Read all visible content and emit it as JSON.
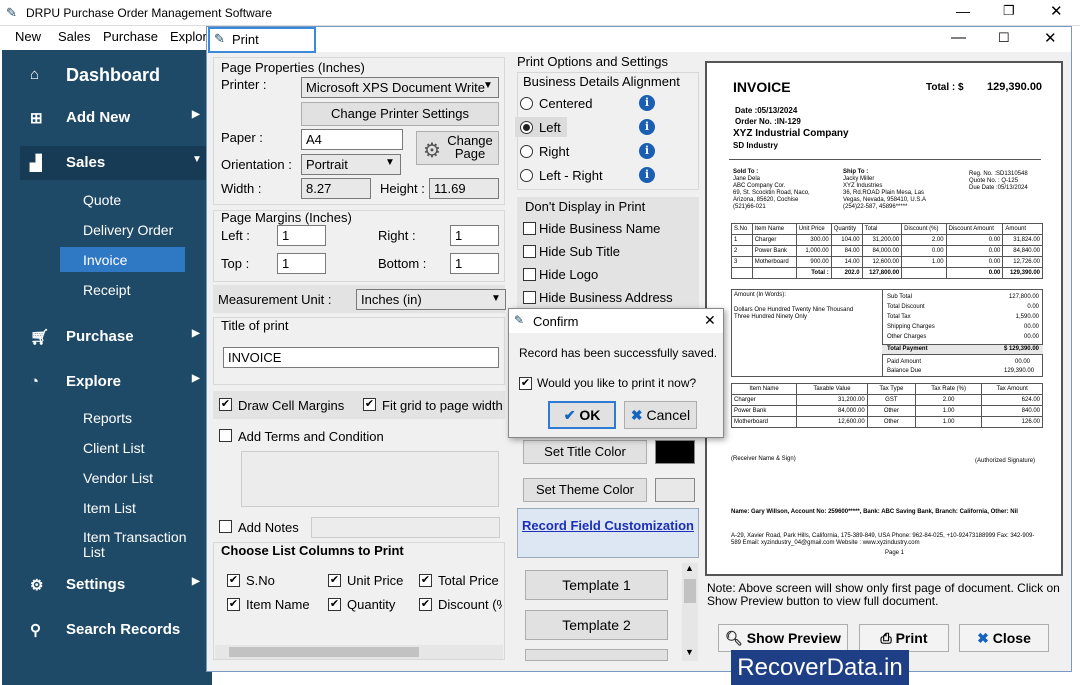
{
  "app": {
    "title": "DRPU Purchase Order Management Software"
  },
  "menu": [
    "New",
    "Sales",
    "Purchase",
    "Explore"
  ],
  "sidebar": {
    "dashboard": "Dashboard",
    "add_new": "Add New",
    "sales": "Sales",
    "sales_sub": [
      "Quote",
      "Delivery Order",
      "Invoice",
      "Receipt"
    ],
    "purchase": "Purchase",
    "explore": "Explore",
    "explore_sub": [
      "Reports",
      "Client List",
      "Vendor List",
      "Item List",
      "Item Transaction List"
    ],
    "settings": "Settings",
    "search": "Search Records"
  },
  "print": {
    "title": "Print",
    "page_properties": {
      "heading": "Page Properties (Inches)",
      "printer_label": "Printer :",
      "printer": "Microsoft XPS Document Write",
      "change_printer": "Change Printer Settings",
      "paper_label": "Paper :",
      "paper": "A4",
      "orientation_label": "Orientation :",
      "orientation": "Portrait",
      "change_page": "Change Page",
      "width_label": "Width :",
      "width": "8.27",
      "height_label": "Height :",
      "height": "11.69"
    },
    "margins": {
      "heading": "Page Margins (Inches)",
      "left_label": "Left :",
      "left": "1",
      "right_label": "Right :",
      "right": "1",
      "top_label": "Top :",
      "top": "1",
      "bottom_label": "Bottom :",
      "bottom": "1"
    },
    "measurement": {
      "label": "Measurement Unit :",
      "value": "Inches (in)"
    },
    "title_of_print": {
      "label": "Title of print",
      "value": "INVOICE"
    },
    "draw_cell_margins": "Draw Cell Margins",
    "fit_grid": "Fit grid to page width",
    "add_terms": "Add Terms and Condition",
    "add_notes": "Add Notes",
    "columns": {
      "heading": "Choose List Columns to Print",
      "items": [
        "S.No",
        "Unit Price",
        "Total Price",
        "Item Name",
        "Quantity",
        "Discount (%"
      ]
    },
    "options": {
      "heading": "Print Options and Settings",
      "alignment": "Business Details Alignment",
      "align_options": [
        "Centered",
        "Left",
        "Right",
        "Left - Right"
      ],
      "selected": "Left",
      "dont_display": "Don't Display in Print",
      "hide": [
        "Hide Business Name",
        "Hide Sub Title",
        "Hide Logo",
        "Hide Business Address"
      ]
    },
    "set_title_color": "Set Title Color",
    "set_theme_color": "Set Theme Color",
    "title_color": "#000000",
    "theme_color": "#e8e8e8",
    "record_field": "Record Field Customization",
    "templates": [
      "Template 1",
      "Template 2"
    ],
    "note": "Note: Above screen will show only first page of document. Click on Show Preview button to view full document.",
    "show_preview": "Show Preview",
    "print_btn": "Print",
    "close_btn": "Close"
  },
  "invoice": {
    "title": "INVOICE",
    "total_label": "Total :  $",
    "total": "129,390.00",
    "date": "Date :05/13/2024",
    "order": "Order No. :IN-129",
    "company": "XYZ Industrial Company",
    "subtitle": "SD Industry",
    "sold_to": [
      "Sold To :",
      "Jane Dela",
      "ABC Company Cor.",
      "69, St. Scocktin Road, Naco,",
      "Arizona, 85620, Cochise",
      "(521)66-021"
    ],
    "ship_to": [
      "Ship To :",
      "Jacky Miller",
      "XYZ Industries",
      "36, Rd.ROAD Plain Mesa, Las",
      "Vegas, Nevada, 958410, U.S.A",
      "(254)22-587, 45896*****"
    ],
    "reg": [
      "Reg. No. :SD1310548",
      "Quote No. : Q-125",
      "Due Date :05/13/2024"
    ],
    "headers": [
      "S.No",
      "Item Name",
      "Unit Price",
      "Quantity",
      "Total",
      "Discount (%)",
      "Discount Amount",
      "Amount"
    ],
    "rows": [
      [
        "1",
        "Charger",
        "300.00",
        "104.00",
        "31,200.00",
        "2.00",
        "0.00",
        "31,824.00"
      ],
      [
        "2",
        "Power Bank",
        "1,000.00",
        "84.00",
        "84,000.00",
        "0.00",
        "0.00",
        "84,840.00"
      ],
      [
        "3",
        "Motherboard",
        "900.00",
        "14.00",
        "12,600.00",
        "1.00",
        "0.00",
        "12,726.00"
      ]
    ],
    "totals_row": [
      "Total :",
      "202.0",
      "127,800.00",
      "0.00",
      "129,390.00"
    ],
    "amount_words_label": "Amount (In Words):",
    "amount_words": "Dollars One Hundred Twenty Nine Thousand Three Hundred Ninety Only",
    "summary": [
      [
        "Sub Total",
        "127,800.00"
      ],
      [
        "Total Discount",
        "0.00"
      ],
      [
        "Total Tax",
        "1,590.00"
      ],
      [
        "Shipping Charges",
        "00.00"
      ],
      [
        "Other Charges",
        "00.00"
      ]
    ],
    "total_payment": [
      "Total Payment",
      "$ 129,390.00"
    ],
    "paid": [
      "Paid Amount",
      "00.00"
    ],
    "balance": [
      "Balance Due",
      "129,390.00"
    ],
    "tax_headers": [
      "Item Name",
      "Taxable Value",
      "Tax Type",
      "Tax Rate (%)",
      "Tax Amount"
    ],
    "tax_rows": [
      [
        "Charger",
        "31,200.00",
        "GST",
        "2.00",
        "624.00"
      ],
      [
        "Power Bank",
        "84,000.00",
        "Other",
        "1.00",
        "840.00"
      ],
      [
        "Motherboard",
        "12,600.00",
        "Other",
        "1.00",
        "126.00"
      ]
    ],
    "receiver": "(Receiver Name & Sign)",
    "authorized": "(Authorized Signature)",
    "bank": "Name: Gary Willson, Account No: 259600*****, Bank: ABC Saving Bank, Branch: California, Other: Nil",
    "address": "A-29, Xavier Road, Park Hills, California, 175-389-849, USA  Phone: 962-84-025, +10-92473188999  Fax: 342-909-589  Email: xyzindustry_04@gmail.com  Website : www.xyzindustry.com",
    "page": "Page 1"
  },
  "confirm": {
    "title": "Confirm",
    "message": "Record has been successfully saved.",
    "question": "Would you like to print it now?",
    "ok": "OK",
    "cancel": "Cancel"
  },
  "watermark": "RecoverData.in"
}
